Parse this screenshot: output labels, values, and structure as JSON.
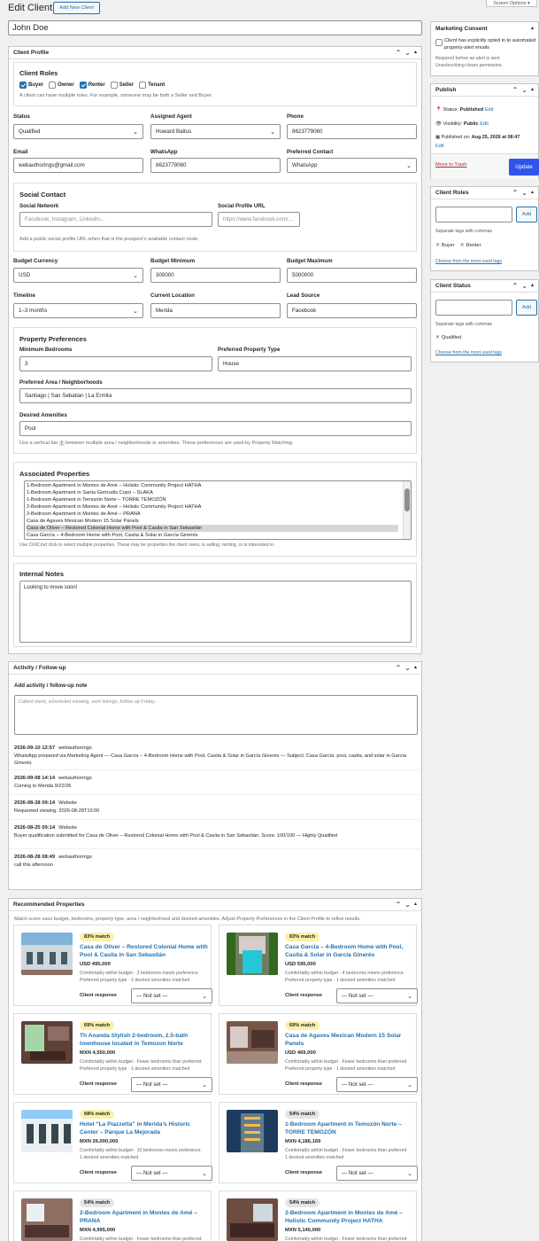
{
  "screen_options": "Screen Options",
  "header": {
    "title": "Edit Client",
    "add_new": "Add New Client"
  },
  "client_name": "John Doe",
  "profile": {
    "title": "Client Profile",
    "roles": {
      "title": "Client Roles",
      "items": [
        {
          "label": "Buyer",
          "checked": true
        },
        {
          "label": "Owner",
          "checked": false
        },
        {
          "label": "Renter",
          "checked": true
        },
        {
          "label": "Seller",
          "checked": false
        },
        {
          "label": "Tenant",
          "checked": false
        }
      ],
      "note": "A client can have multiple roles. For example, someone may be both a Seller and Buyer."
    },
    "status": {
      "label": "Status",
      "value": "Qualified"
    },
    "agent": {
      "label": "Assigned Agent",
      "value": "Howard Baltus"
    },
    "phone": {
      "label": "Phone",
      "value": "8623779060"
    },
    "email": {
      "label": "Email",
      "value": "webauthorings@gmail.com"
    },
    "whatsapp": {
      "label": "WhatsApp",
      "value": "8623779060"
    },
    "preferred_contact": {
      "label": "Preferred Contact",
      "value": "WhatsApp"
    },
    "social": {
      "title": "Social Contact",
      "network_label": "Social Network",
      "network_placeholder": "Facebook, Instagram, LinkedIn...",
      "url_label": "Social Profile URL",
      "url_placeholder": "https://www.facebook.com/...",
      "note": "Add a public social profile URL when that is the prospect's available contact route."
    },
    "budget_currency": {
      "label": "Budget Currency",
      "value": "USD"
    },
    "budget_min": {
      "label": "Budget Minimum",
      "value": "300000"
    },
    "budget_max": {
      "label": "Budget Maximum",
      "value": "5000000"
    },
    "timeline": {
      "label": "Timeline",
      "value": "1–3 months"
    },
    "current_location": {
      "label": "Current Location",
      "value": "Merida"
    },
    "lead_source": {
      "label": "Lead Source",
      "value": "Facebook"
    },
    "preferences": {
      "title": "Property Preferences",
      "min_bed_label": "Minimum Bedrooms",
      "min_bed_value": "3",
      "type_label": "Preferred Property Type",
      "type_value": "House",
      "area_label": "Preferred Area / Neighborhoods",
      "area_value": "Santiago | San Sebatian | La Ermita",
      "amenities_label": "Desired Amenities",
      "amenities_value": "Pool",
      "note_a": "Use a vertical bar",
      "note_bar": "|",
      "note_b": "between multiple area / neighborhoods or amenities. These preferences are used by Property Matching."
    },
    "associated": {
      "title": "Associated Properties",
      "options": [
        "1-Bedroom Apartment in Montes de Amé – Holistic Community Project HATHA",
        "1-Bedroom Apartment in Santa Gertrudis Copó – SLAKA",
        "1-Bedroom Apartment in Temozón Norte – TORRE TEMOZÓN",
        "2-Bedroom Apartment in Montes de Amé – Holistic Community Project HATHA",
        "2-Bedroom Apartment in Montes de Amé – PRANA",
        "Casa de Agaves Mexican Modern 15 Solar Panels",
        "Casa de Oliver – Restored Colonial Home with Pool & Casita in San Sebastián",
        "Casa García – 4-Bedroom Home with Pool, Casita & Solar in García Ginerés"
      ],
      "note": "Use Ctrl/Cmd click to select multiple properties. These may be properties the client owns, is selling, renting, or is interested in."
    },
    "notes": {
      "title": "Internal Notes",
      "value": "Looking to move soon!"
    }
  },
  "activity": {
    "title": "Activity / Follow-up",
    "add_label": "Add activity / follow-up note",
    "placeholder": "Called client, scheduled viewing, sent listings, follow up Friday.",
    "entries": [
      {
        "when": "2026-09-10 12:57",
        "who": "webauthorings",
        "text": "WhatsApp prepared via Marketing Agent — Casa García – 4-Bedroom Home with Pool, Casita & Solar in García Ginerés — Subject: Casa García: pool, casita, and solar in García Ginerés"
      },
      {
        "when": "2026-09-08 14:14",
        "who": "webauthorings",
        "text": "Coming to Merida 9/22/26"
      },
      {
        "when": "2026-08-28 09:14",
        "who": "Website",
        "text": "Requested viewing: 2026-08-28T10:00"
      },
      {
        "when": "2026-08-25 09:14",
        "who": "Website",
        "text": "Buyer qualification submitted for Casa de Oliver – Restored Colonial Home with Pool & Casita in San Sebastián. Score: 100/100 — Highly Qualified"
      },
      {
        "when": "2026-08-28 08:49",
        "who": "webauthorings",
        "text": "call this afternoon"
      }
    ]
  },
  "recommended": {
    "title": "Recommended Properties",
    "intro": "Match score uses budget, bedrooms, property type, area / neighborhood and desired amenities. Adjust Property Preferences in the Client Profile to refine results.",
    "response_label": "Client response",
    "not_set": "— Not set —",
    "cards": [
      {
        "match": "83% match",
        "title": "Casa de Oliver – Restored Colonial Home with Pool & Casita in San Sebastián",
        "price": "USD 495,000",
        "meta1": "Comfortably within budget · 3 bedrooms meets preference",
        "meta2": "Preferred property type · 1 desired amenities matched",
        "badge_color": "#fcf0a8",
        "img": "colonial"
      },
      {
        "match": "83% match",
        "title": "Casa García – 4-Bedroom Home with Pool, Casita & Solar in García Ginerés",
        "price": "USD 595,000",
        "meta1": "Comfortably within budget · 4 bedrooms meets preference",
        "meta2": "Preferred property type · 1 desired amenities matched",
        "badge_color": "#fcf0a8",
        "img": "pool"
      },
      {
        "match": "69% match",
        "title": "Th Ananda Stylish 2-bedroom, 2.5-bath townhouse located in Temozon Norte",
        "price": "MXN 4,550,000",
        "meta1": "Comfortably within budget · Fewer bedrooms than preferred",
        "meta2": "Preferred property type · 1 desired amenities matched",
        "badge_color": "#fcf0a8",
        "img": "interior"
      },
      {
        "match": "69% match",
        "title": "Casa de Agaves Mexican Modern 15 Solar Panels",
        "price": "USD 469,000",
        "meta1": "Comfortably within budget · Fewer bedrooms than preferred",
        "meta2": "Preferred property type · 1 desired amenities matched",
        "badge_color": "#fcf0a8",
        "img": "modern"
      },
      {
        "match": "68% match",
        "title": "Hotel “La Piazzetta” in Mérida’s Historic Center – Parque La Mejorada",
        "price": "MXN 26,000,000",
        "meta1": "Comfortably within budget · 10 bedrooms meets preference",
        "meta2": "1 desired amenities matched",
        "badge_color": "#fcf0a8",
        "img": "hotel"
      },
      {
        "match": "54% match",
        "title": "1-Bedroom Apartment in Temozón Norte – TORRE TEMOZÓN",
        "price": "MXN 4,186,169",
        "meta1": "Comfortably within budget · Fewer bedrooms than preferred",
        "meta2": "1 desired amenities matched",
        "badge_color": "#e5e5e5",
        "img": "tower"
      },
      {
        "match": "54% match",
        "title": "2-Bedroom Apartment in Montes de Amé – PRANA",
        "price": "MXN 4,995,000",
        "meta1": "Comfortably within budget · Fewer bedrooms than preferred",
        "meta2": "",
        "badge_color": "#e5e5e5",
        "img": "room"
      },
      {
        "match": "54% match",
        "title": "2-Bedroom Apartment in Montes de Amé – Holistic Community Project HATHA",
        "price": "MXN 5,145,000",
        "meta1": "Comfortably within budget · Fewer bedrooms than preferred",
        "meta2": "",
        "badge_color": "#e5e5e5",
        "img": "room2"
      }
    ]
  },
  "sidebar": {
    "consent": {
      "title": "Marketing Consent",
      "checkbox": "Client has explicitly opted in to automated property-alert emails",
      "note1": "Required before an alert is sent.",
      "note2": "Unsubscribing clears permission."
    },
    "publish": {
      "title": "Publish",
      "status_label": "Status:",
      "status_value": "Published",
      "edit": "Edit",
      "visibility_label": "Visibility:",
      "visibility_value": "Public",
      "published_label": "Published on:",
      "published_value": "Aug 25, 2026 at 08:47",
      "trash": "Move to Trash",
      "update": "Update"
    },
    "roles": {
      "title": "Client Roles",
      "add": "Add",
      "hint": "Separate tags with commas",
      "tags": [
        "Buyer",
        "Renter"
      ],
      "choose": "Choose from the most used tags"
    },
    "status": {
      "title": "Client Status",
      "add": "Add",
      "hint": "Separate tags with commas",
      "tags": [
        "Qualified"
      ],
      "choose": "Choose from the most used tags"
    }
  },
  "colors": {
    "accent": "#2271b1",
    "update_btn": "#2f54eb",
    "trash": "#b32d2e"
  }
}
